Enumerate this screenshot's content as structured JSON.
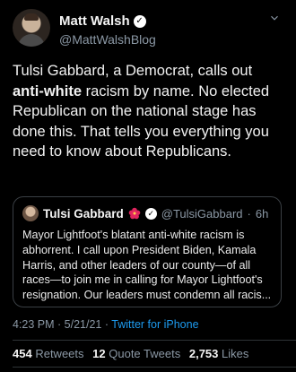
{
  "author": {
    "name": "Matt Walsh",
    "handle": "@MattWalshBlog",
    "verified_icon": "verified-badge-icon"
  },
  "tweet": {
    "text_parts": [
      "Tulsi Gabbard, a Democrat, calls out ",
      "anti-white",
      " racism by name. No elected Republican on the national stage has done this. That tells you everything you need to know about Republicans."
    ]
  },
  "quoted": {
    "name": "Tulsi Gabbard",
    "handle": "@TulsiGabbard",
    "separator": "·",
    "time": "6h",
    "emoji_icon": "hibiscus-icon",
    "text": "Mayor Lightfoot's blatant anti-white racism is abhorrent. I call upon President Biden, Kamala Harris, and other leaders of our county—of all races—to join me in calling for Mayor Lightfoot's resignation. Our leaders must condemn all racis..."
  },
  "meta": {
    "timestamp": "4:23 PM · 5/21/21 · ",
    "source": "Twitter for iPhone"
  },
  "stats": {
    "retweets_count": "454",
    "retweets_label": "Retweets",
    "quotes_count": "12",
    "quotes_label": "Quote Tweets",
    "likes_count": "2,753",
    "likes_label": "Likes"
  },
  "colors": {
    "background": "#000000",
    "link": "#1d9bf0",
    "secondary_text": "#8b98a5"
  }
}
